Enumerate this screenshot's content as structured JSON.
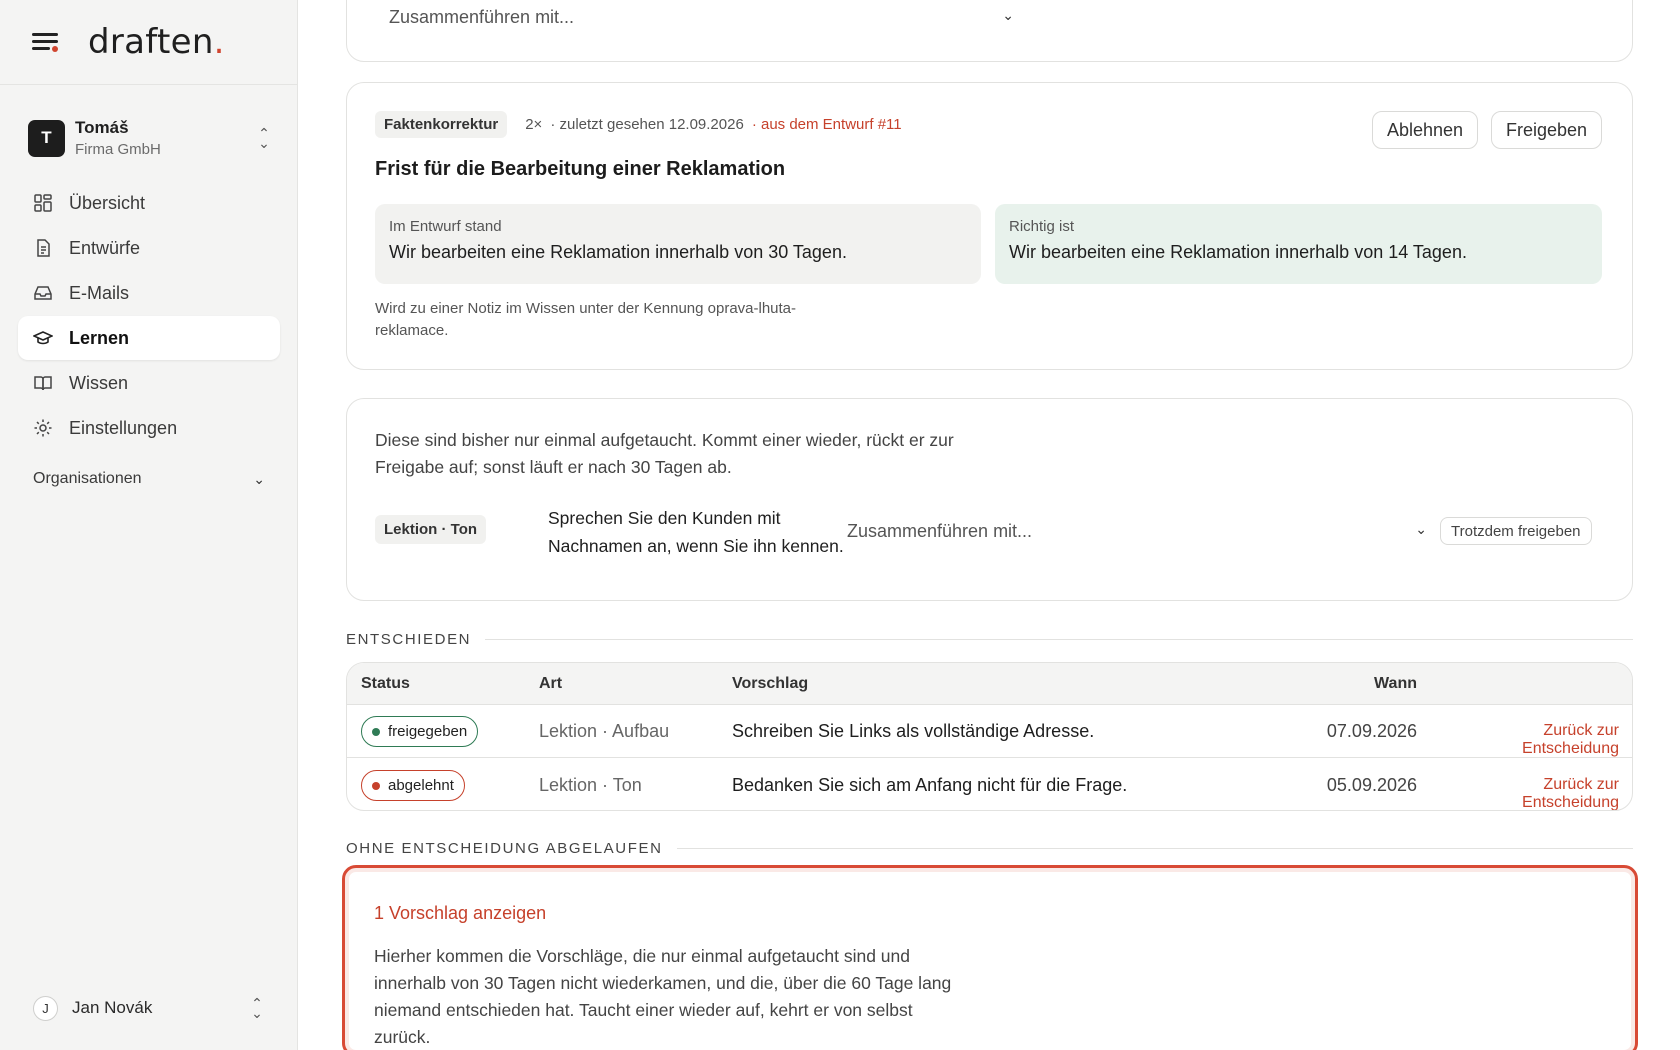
{
  "brand": {
    "logo_text": "draften",
    "logo_dot": "."
  },
  "account": {
    "initial": "T",
    "name": "Tomáš",
    "company": "Firma GmbH"
  },
  "nav": {
    "items": [
      {
        "label": "Übersicht"
      },
      {
        "label": "Entwürfe"
      },
      {
        "label": "E-Mails"
      },
      {
        "label": "Lernen"
      },
      {
        "label": "Wissen"
      },
      {
        "label": "Einstellungen"
      }
    ],
    "organizations_label": "Organisationen"
  },
  "user": {
    "initial": "J",
    "name": "Jan Novák"
  },
  "top_card": {
    "merge_placeholder": "Zusammenführen mit..."
  },
  "fact_card": {
    "tag": "Faktenkorrektur",
    "count": "2×",
    "last_seen": "· zuletzt gesehen 12.09.2026",
    "source": "· aus dem Entwurf #11",
    "title": "Frist für die Bearbeitung einer Reklamation",
    "reject_label": "Ablehnen",
    "approve_label": "Freigeben",
    "old_label": "Im Entwurf stand",
    "old_text": "Wir bearbeiten eine Reklamation innerhalb von 30 Tagen.",
    "new_label": "Richtig ist",
    "new_text": "Wir bearbeiten eine Reklamation innerhalb von 14 Tagen.",
    "note": "Wird zu einer Notiz im Wissen unter der Kennung oprava-lhuta-reklamace."
  },
  "pending_card": {
    "text": "Diese sind bisher nur einmal aufgetaucht. Kommt einer wieder, rückt er zur Freigabe auf; sonst läuft er nach 30 Tagen ab.",
    "tag": "Lektion · Ton",
    "lesson": "Sprechen Sie den Kunden mit Nachnamen an, wenn Sie ihn kennen.",
    "merge_placeholder": "Zusammenführen mit...",
    "force_label": "Trotzdem freigeben"
  },
  "decided": {
    "heading": "ENTSCHIEDEN",
    "columns": {
      "status": "Status",
      "art": "Art",
      "suggestion": "Vorschlag",
      "when": "Wann"
    },
    "rows": [
      {
        "status": "freigegeben",
        "art": "Lektion · Aufbau",
        "suggestion": "Schreiben Sie Links als vollständige Adresse.",
        "date": "07.09.2026",
        "action": "Zurück zur Entscheidung"
      },
      {
        "status": "abgelehnt",
        "art": "Lektion · Ton",
        "suggestion": "Bedanken Sie sich am Anfang nicht für die Frage.",
        "date": "05.09.2026",
        "action": "Zurück zur Entscheidung"
      }
    ]
  },
  "expired": {
    "heading": "OHNE ENTSCHEIDUNG ABGELAUFEN",
    "show_label": "1 Vorschlag anzeigen",
    "text": "Hierher kommen die Vorschläge, die nur einmal aufgetaucht sind und innerhalb von 30 Tagen nicht wiederkamen, und die, über die 60 Tage lang niemand entschieden hat. Taucht einer wieder auf, kehrt er von selbst zurück."
  },
  "colors": {
    "accent": "#c6412b",
    "approved": "#2f7b55",
    "highlight_border": "#d84a35"
  }
}
